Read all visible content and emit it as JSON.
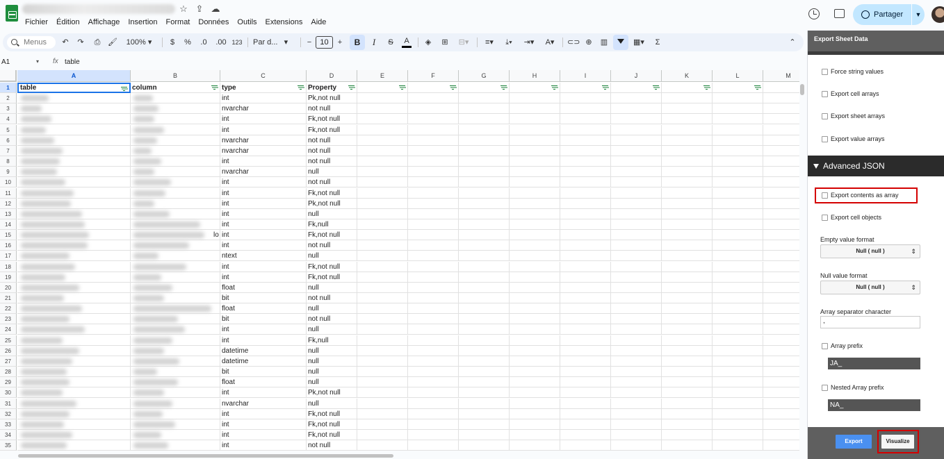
{
  "menu": [
    "Fichier",
    "Édition",
    "Affichage",
    "Insertion",
    "Format",
    "Données",
    "Outils",
    "Extensions",
    "Aide"
  ],
  "share_label": "Partager",
  "toolbar": {
    "search_placeholder": "Menus",
    "zoom": "100%",
    "currency": "$",
    "percent": "%",
    "dec_less": ".0",
    "dec_more": ".00",
    "num_format": "123",
    "font": "Par d...",
    "font_size": "10",
    "bold": "B",
    "italic": "I",
    "strike": "S",
    "text_color": "A",
    "sum": "Σ"
  },
  "formula_bar": {
    "cell_ref": "A1",
    "fx": "fx",
    "value": "table"
  },
  "columns": [
    "A",
    "B",
    "C",
    "D",
    "E",
    "F",
    "G",
    "H",
    "I",
    "J",
    "K",
    "L",
    "M"
  ],
  "header_row": {
    "table": "table",
    "column": "column",
    "type": "type",
    "property": "Property"
  },
  "rows": [
    {
      "n": "2",
      "type": "int",
      "prop": "Pk,not null"
    },
    {
      "n": "3",
      "type": "nvarchar",
      "prop": "not null"
    },
    {
      "n": "4",
      "type": "int",
      "prop": "Fk,not null"
    },
    {
      "n": "5",
      "type": "int",
      "prop": "Fk,not null"
    },
    {
      "n": "6",
      "type": "nvarchar",
      "prop": "not null"
    },
    {
      "n": "7",
      "type": "nvarchar",
      "prop": "not null"
    },
    {
      "n": "8",
      "type": "int",
      "prop": "not null"
    },
    {
      "n": "9",
      "type": "nvarchar",
      "prop": "null"
    },
    {
      "n": "10",
      "type": "int",
      "prop": "not null"
    },
    {
      "n": "11",
      "type": "int",
      "prop": "Fk,not null"
    },
    {
      "n": "12",
      "type": "int",
      "prop": "Pk,not null"
    },
    {
      "n": "13",
      "type": "int",
      "prop": "null"
    },
    {
      "n": "14",
      "type": "int",
      "prop": "Fk,null"
    },
    {
      "n": "15",
      "type": "int",
      "prop": "Fk,not null"
    },
    {
      "n": "16",
      "type": "int",
      "prop": "not null"
    },
    {
      "n": "17",
      "type": "ntext",
      "prop": "null"
    },
    {
      "n": "18",
      "type": "int",
      "prop": "Fk,not null"
    },
    {
      "n": "19",
      "type": "int",
      "prop": "Fk,not null"
    },
    {
      "n": "20",
      "type": "float",
      "prop": "null"
    },
    {
      "n": "21",
      "type": "bit",
      "prop": "not null"
    },
    {
      "n": "22",
      "type": "float",
      "prop": "null"
    },
    {
      "n": "23",
      "type": "bit",
      "prop": "not null"
    },
    {
      "n": "24",
      "type": "int",
      "prop": "null"
    },
    {
      "n": "25",
      "type": "int",
      "prop": "Fk,null"
    },
    {
      "n": "26",
      "type": "datetime",
      "prop": "null"
    },
    {
      "n": "27",
      "type": "datetime",
      "prop": "null"
    },
    {
      "n": "28",
      "type": "bit",
      "prop": "null"
    },
    {
      "n": "29",
      "type": "float",
      "prop": "null"
    },
    {
      "n": "30",
      "type": "int",
      "prop": "Pk,not null"
    },
    {
      "n": "31",
      "type": "nvarchar",
      "prop": "null"
    },
    {
      "n": "32",
      "type": "int",
      "prop": "Fk,not null"
    },
    {
      "n": "33",
      "type": "int",
      "prop": "Fk,not null"
    },
    {
      "n": "34",
      "type": "int",
      "prop": "Fk,not null"
    },
    {
      "n": "35",
      "type": "int",
      "prop": "not null"
    }
  ],
  "row15_overflow": "lo",
  "sidebar": {
    "title": "Export Sheet Data",
    "options_top": [
      "Force string values",
      "Export cell arrays",
      "Export sheet arrays",
      "Export value arrays"
    ],
    "advanced_title": "Advanced JSON",
    "export_contents_as_array": "Export contents as array",
    "export_cell_objects": "Export cell objects",
    "empty_value_format_label": "Empty value format",
    "empty_value_format": "Null ( null )",
    "null_value_format_label": "Null value format",
    "null_value_format": "Null ( null )",
    "array_sep_label": "Array separator character",
    "array_sep_value": ",",
    "array_prefix_label": "Array prefix",
    "array_prefix_value": "JA_",
    "nested_prefix_label": "Nested Array prefix",
    "nested_prefix_value": "NA_",
    "export_button": "Export",
    "visualize_button": "Visualize"
  },
  "highlight_color": "#d40000"
}
